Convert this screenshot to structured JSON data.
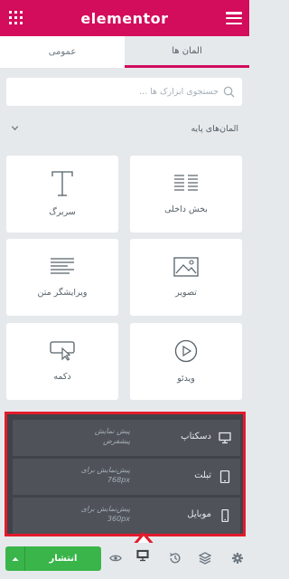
{
  "header": {
    "logo_text": "elementor",
    "menu_icon": "hamburger-menu-icon",
    "grid_icon": "apps-grid-icon"
  },
  "tabs": [
    {
      "label": "عمومی",
      "active": false
    },
    {
      "label": "المان ها",
      "active": true
    }
  ],
  "search": {
    "placeholder": "جستجوی ابزارک ها ..."
  },
  "section": {
    "title": "المان‌های پایه"
  },
  "widgets": [
    {
      "label": "بخش داخلی",
      "icon": "inner-section-icon"
    },
    {
      "label": "سربرگ",
      "icon": "heading-icon"
    },
    {
      "label": "تصویر",
      "icon": "image-icon"
    },
    {
      "label": "ویرایشگر متن",
      "icon": "text-editor-icon"
    },
    {
      "label": "ویدئو",
      "icon": "video-icon"
    },
    {
      "label": "دکمه",
      "icon": "button-icon"
    }
  ],
  "responsive": {
    "items": [
      {
        "name": "دسکتاپ",
        "desc": "پیش نمایش پیشفرض",
        "icon": "desktop-icon"
      },
      {
        "name": "تبلت",
        "desc": "پیش‌نمایش برای 768px",
        "icon": "tablet-icon"
      },
      {
        "name": "موبایل",
        "desc": "پیش‌نمایش برای 360px",
        "icon": "mobile-icon"
      }
    ]
  },
  "footer": {
    "publish_label": "انتشار",
    "icons": [
      "settings-icon",
      "layers-icon",
      "history-icon",
      "responsive-icon",
      "preview-icon"
    ]
  },
  "colors": {
    "brand": "#d30c5c",
    "publish": "#39b54a",
    "highlight": "#e21b2c",
    "popover": "#404349"
  }
}
